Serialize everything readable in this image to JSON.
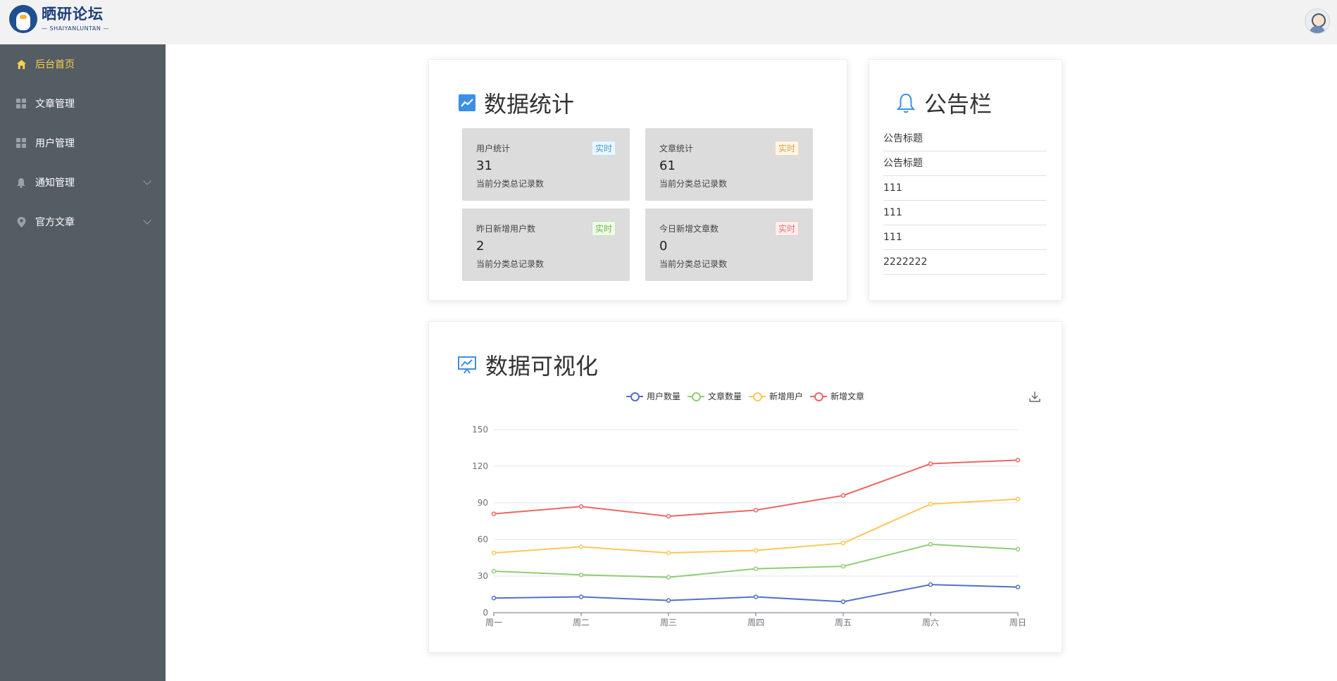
{
  "header": {
    "logo_cn": "晒研论坛",
    "logo_en": "— SHAIYANLUNTAN —"
  },
  "sidebar": {
    "items": [
      {
        "label": "后台首页",
        "icon": "home-icon",
        "active": true
      },
      {
        "label": "文章管理",
        "icon": "grid-icon"
      },
      {
        "label": "用户管理",
        "icon": "grid-icon"
      },
      {
        "label": "通知管理",
        "icon": "bell-icon",
        "submenu": true
      },
      {
        "label": "官方文章",
        "icon": "location-icon",
        "submenu": true
      }
    ]
  },
  "stats": {
    "title": "数据统计",
    "cards": [
      {
        "label": "用户统计",
        "tag": "实时",
        "value": "31",
        "sub": "当前分类总记录数",
        "tag_color": "blue"
      },
      {
        "label": "文章统计",
        "tag": "实时",
        "value": "61",
        "sub": "当前分类总记录数",
        "tag_color": "orange"
      },
      {
        "label": "昨日新增用户数",
        "tag": "实时",
        "value": "2",
        "sub": "当前分类总记录数",
        "tag_color": "green"
      },
      {
        "label": "今日新增文章数",
        "tag": "实时",
        "value": "0",
        "sub": "当前分类总记录数",
        "tag_color": "red"
      }
    ]
  },
  "notice": {
    "title": "公告栏",
    "items": [
      "公告标题",
      "公告标题",
      "111",
      "111",
      "111",
      "2222222"
    ]
  },
  "visual": {
    "title": "数据可视化"
  },
  "chart_data": {
    "type": "line",
    "categories": [
      "周一",
      "周二",
      "周三",
      "周四",
      "周五",
      "周六",
      "周日"
    ],
    "series": [
      {
        "name": "用户数量",
        "values": [
          12,
          13,
          10,
          13,
          9,
          23,
          21
        ],
        "color": "#5470c6"
      },
      {
        "name": "文章数量",
        "values": [
          34,
          31,
          29,
          36,
          38,
          56,
          52
        ],
        "color": "#91cc75"
      },
      {
        "name": "新增用户",
        "values": [
          49,
          54,
          49,
          51,
          57,
          89,
          93
        ],
        "color": "#fac858"
      },
      {
        "name": "新增文章",
        "values": [
          81,
          87,
          79,
          84,
          96,
          122,
          125
        ],
        "color": "#ee6666"
      }
    ],
    "ylim": [
      0,
      150
    ],
    "yticks": [
      0,
      30,
      60,
      90,
      120,
      150
    ],
    "grid": true,
    "legend": "top-center"
  }
}
